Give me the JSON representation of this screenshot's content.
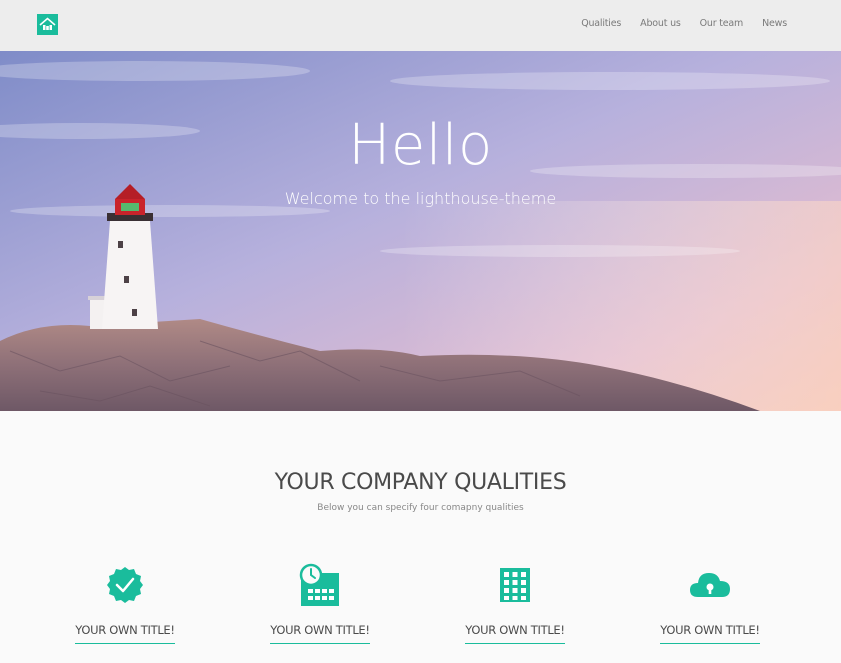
{
  "nav": {
    "logo_icon": "lighthouse-house-icon",
    "links": [
      "Qualities",
      "About us",
      "Our team",
      "News"
    ]
  },
  "hero": {
    "title": "Hello",
    "subtitle": "Welcome to the lighthouse-theme"
  },
  "qualities": {
    "title": "YOUR COMPANY QUALITIES",
    "subtitle": "Below you can specify four comapny qualities",
    "features": [
      {
        "icon": "badge-check-icon",
        "title": "YOUR OWN TITLE!"
      },
      {
        "icon": "calendar-clock-icon",
        "title": "YOUR OWN TITLE!"
      },
      {
        "icon": "grid-building-icon",
        "title": "YOUR OWN TITLE!"
      },
      {
        "icon": "cloud-lock-icon",
        "title": "YOUR OWN TITLE!"
      }
    ]
  },
  "colors": {
    "accent": "#1abc9c",
    "navbar": "#ededed"
  }
}
